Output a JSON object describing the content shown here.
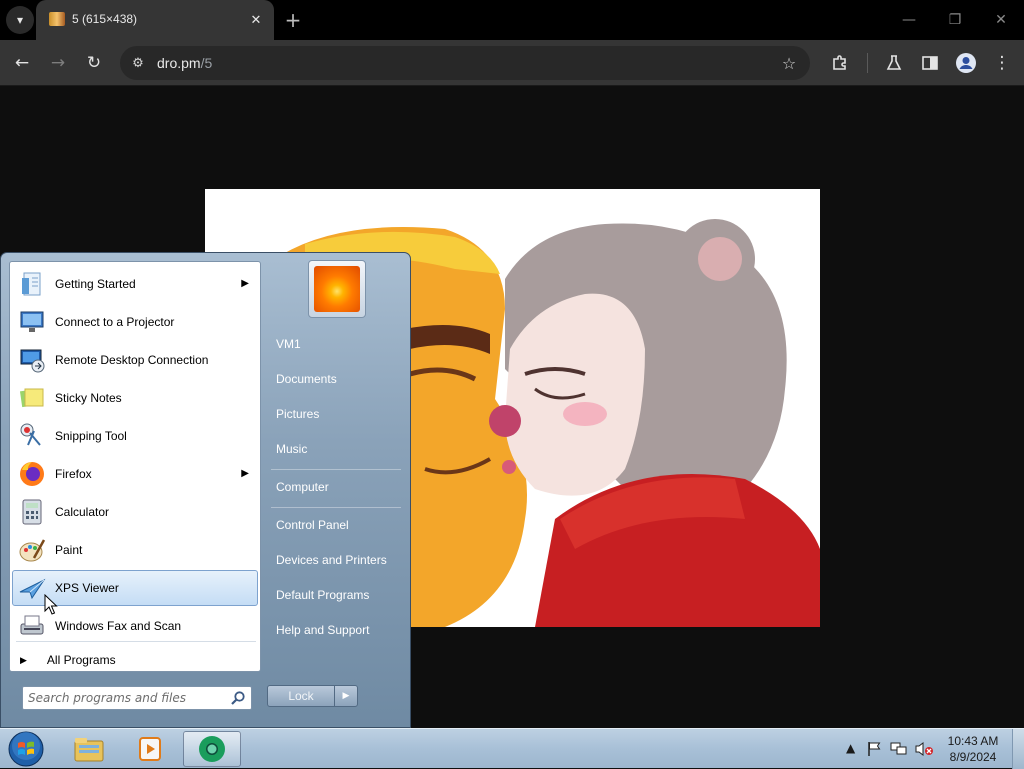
{
  "browser": {
    "tab_title": "5 (615×438)",
    "url_host": "dro.pm",
    "url_path": "/5",
    "icons": [
      "tab-list-icon",
      "close-icon",
      "plus-icon",
      "minimize-icon",
      "restore-icon",
      "window-close-icon",
      "back-icon",
      "forward-icon",
      "reload-icon",
      "site-settings-icon",
      "bookmark-star-icon",
      "extensions-icon",
      "labs-icon",
      "side-panel-icon",
      "profile-icon",
      "menu-kebab-icon"
    ]
  },
  "start_menu": {
    "programs": [
      {
        "label": "Getting Started",
        "icon": "getting-started-icon",
        "has_submenu": true
      },
      {
        "label": "Connect to a Projector",
        "icon": "projector-icon",
        "has_submenu": false
      },
      {
        "label": "Remote Desktop Connection",
        "icon": "remote-desktop-icon",
        "has_submenu": false
      },
      {
        "label": "Sticky Notes",
        "icon": "sticky-notes-icon",
        "has_submenu": false
      },
      {
        "label": "Snipping Tool",
        "icon": "snipping-tool-icon",
        "has_submenu": false
      },
      {
        "label": "Firefox",
        "icon": "firefox-icon",
        "has_submenu": true
      },
      {
        "label": "Calculator",
        "icon": "calculator-icon",
        "has_submenu": false
      },
      {
        "label": "Paint",
        "icon": "paint-icon",
        "has_submenu": false
      },
      {
        "label": "XPS Viewer",
        "icon": "xps-viewer-icon",
        "has_submenu": false,
        "highlighted": true
      },
      {
        "label": "Windows Fax and Scan",
        "icon": "fax-scan-icon",
        "has_submenu": false
      }
    ],
    "all_programs": "All Programs",
    "search_placeholder": "Search programs and files",
    "right_links": {
      "user": "VM1",
      "documents": "Documents",
      "pictures": "Pictures",
      "music": "Music",
      "computer": "Computer",
      "control_panel": "Control Panel",
      "devices": "Devices and Printers",
      "default_programs": "Default Programs",
      "help": "Help and Support"
    },
    "power_button": "Lock"
  },
  "taskbar": {
    "items": [
      "windows-explorer-icon",
      "media-player-icon",
      "chrome-icon"
    ],
    "time": "10:43 AM",
    "date": "8/9/2024"
  }
}
